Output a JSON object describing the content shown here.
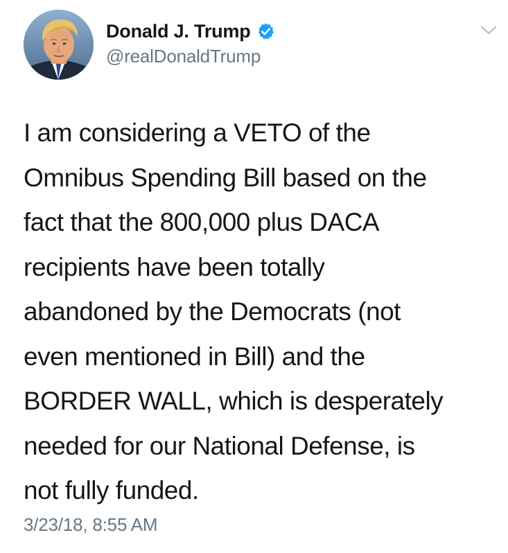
{
  "author": {
    "display_name": "Donald J. Trump",
    "handle": "@realDonaldTrump",
    "verified": true
  },
  "icons": {
    "avatar": "profile-photo",
    "verified": "verified-badge-icon",
    "menu": "chevron-down-icon"
  },
  "tweet": {
    "lines": [
      "I am considering a VETO of the",
      "Omnibus Spending Bill based on the",
      "fact that the 800,000 plus DACA",
      "recipients have been totally",
      "abandoned by the Democrats (not",
      "even mentioned in Bill) and the",
      "BORDER WALL, which is desperately",
      "needed for our National Defense, is",
      "not fully funded."
    ],
    "timestamp": "3/23/18, 8:55 AM"
  },
  "colors": {
    "text": "#14171a",
    "secondary": "#657786",
    "verified_blue": "#1da1f2",
    "chevron": "#aab8c2"
  }
}
